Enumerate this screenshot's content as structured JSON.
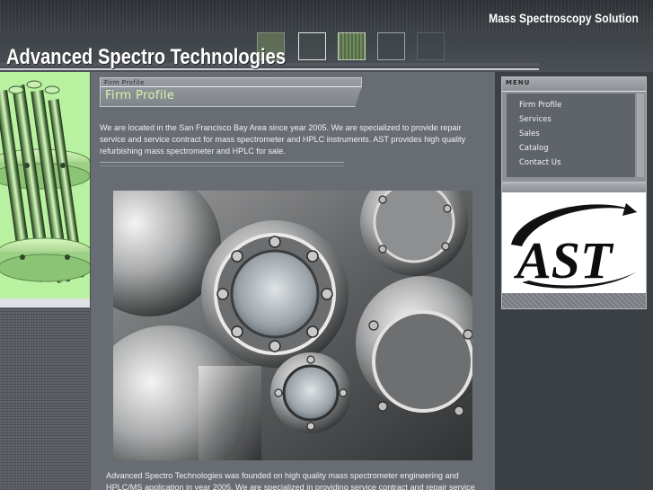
{
  "header": {
    "tagline": "Mass Spectroscopy Solution",
    "site_title": "Advanced Spectro Technologies"
  },
  "firm_profile": {
    "small_label": "Firm Profile",
    "title": "Firm Profile"
  },
  "content": {
    "intro": "We are located in the San Francisco Bay Area since year 2005. We are specialized to provide repair service and service contract for mass spectrometer and HPLC instruments. AST provides high quality refurbishing mass spectrometer and HPLC for sale.",
    "founded": "Advanced Spectro Technologies was founded on high quality mass spectrometer engineering and HPLC/MS application in year 2005. We are specialized in providing service contract and repair service for"
  },
  "menu": {
    "heading": "MENU",
    "items": [
      {
        "label": "Firm Profile"
      },
      {
        "label": "Services"
      },
      {
        "label": "Sales"
      },
      {
        "label": "Catalog"
      },
      {
        "label": "Contact Us"
      }
    ]
  },
  "logo": {
    "text": "AST"
  },
  "colors": {
    "accent_green": "#d6f5a6",
    "left_panel_green": "#b8f2a0",
    "main_bg": "#686d73",
    "page_bg": "#3b4045"
  }
}
